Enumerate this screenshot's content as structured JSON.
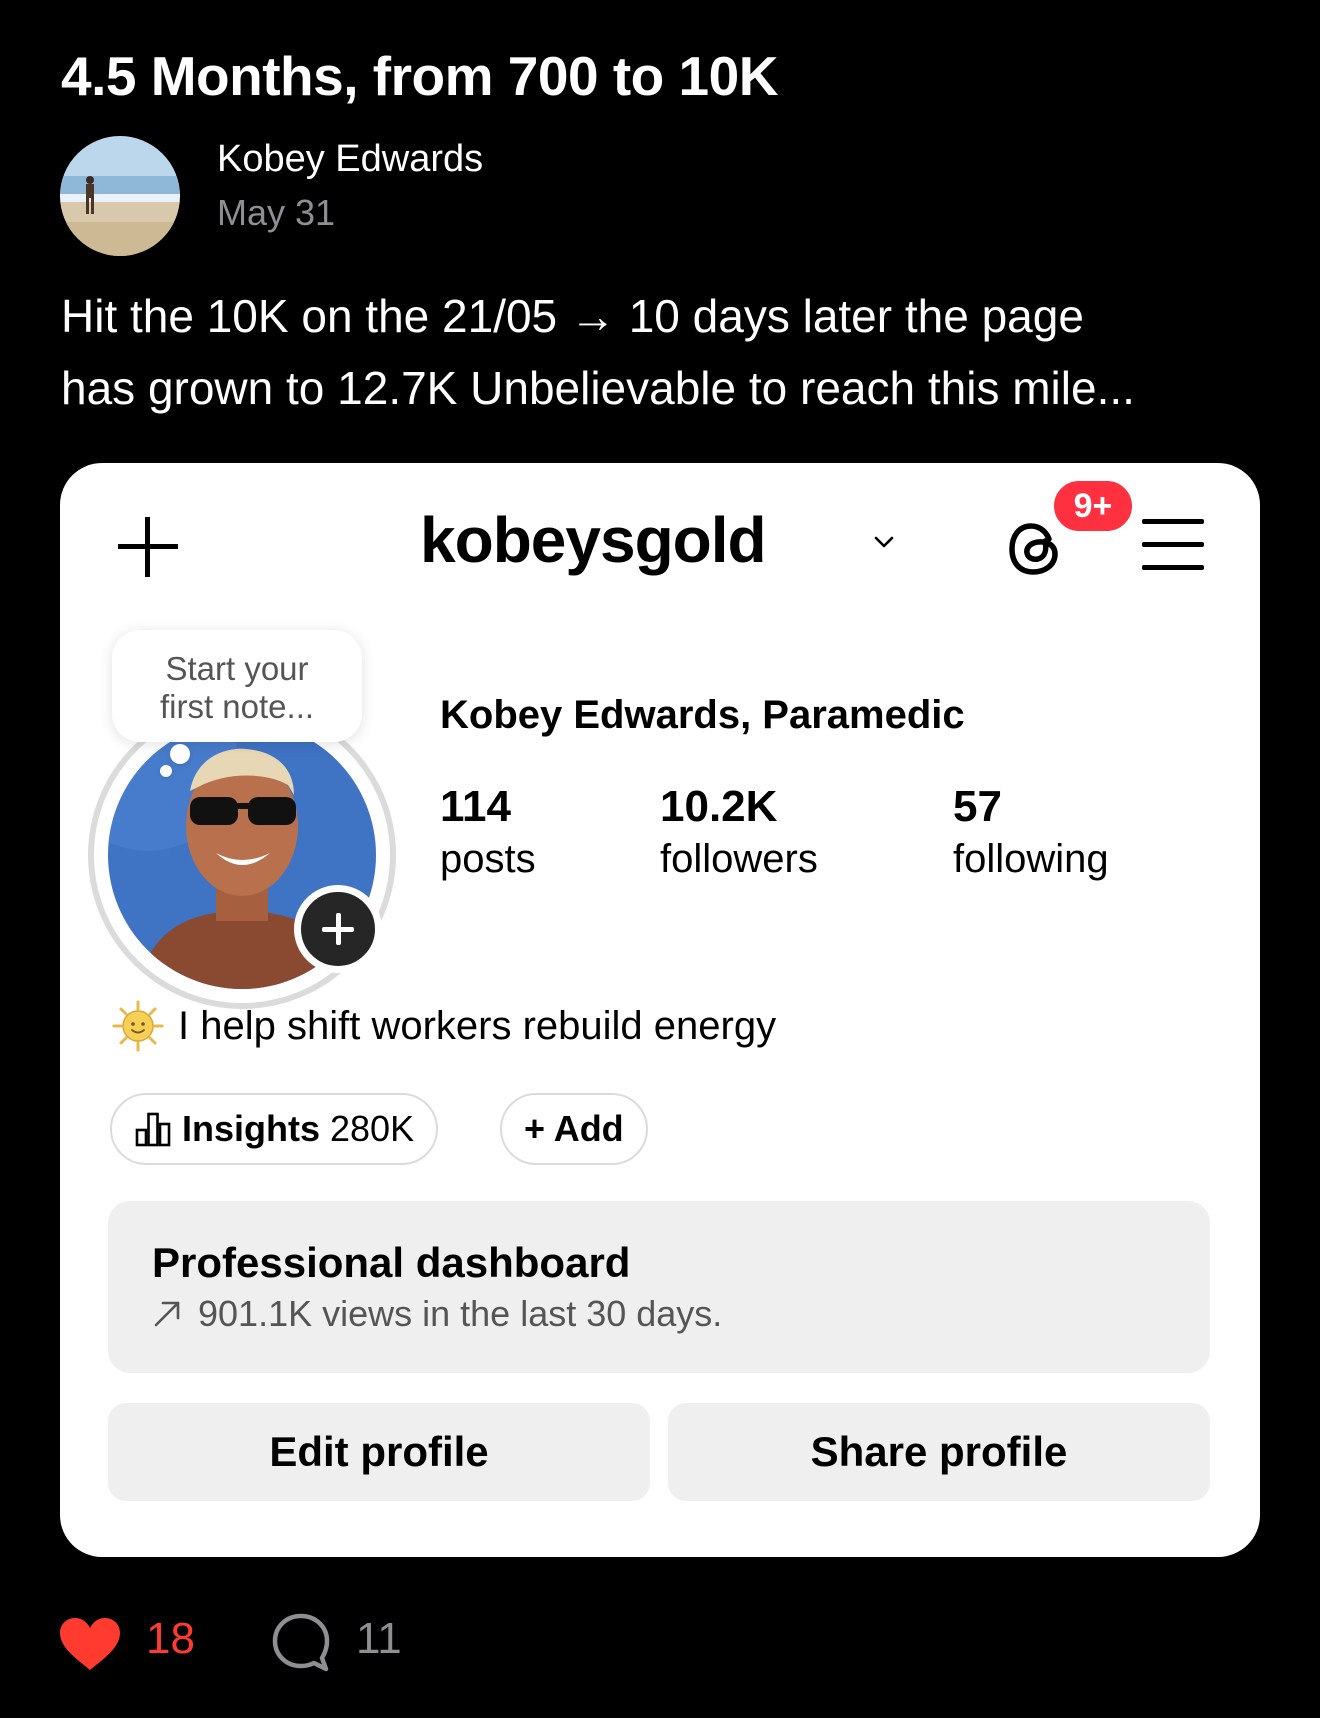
{
  "post": {
    "title": "4.5 Months, from 700 to 10K",
    "author": "Kobey Edwards",
    "date": "May 31",
    "body_line1": "Hit the 10K on the 21/05 → 10 days later the page",
    "body_line2": "has grown to 12.7K  Unbelievable to reach this mile..."
  },
  "profile": {
    "username": "kobeysgold",
    "notification_badge": "9+",
    "note_line1": "Start your",
    "note_line2": "first note...",
    "display_name": "Kobey Edwards, Paramedic",
    "stats": [
      {
        "value": "114",
        "label": "posts"
      },
      {
        "value": "10.2K",
        "label": "followers"
      },
      {
        "value": "57",
        "label": "following"
      }
    ],
    "bio": "I help shift workers rebuild energy",
    "insights_label": "Insights",
    "insights_value": "280K",
    "add_label": "+ Add",
    "dashboard_title": "Professional dashboard",
    "dashboard_subtitle": "901.1K views in the last 30 days.",
    "edit_profile": "Edit profile",
    "share_profile": "Share profile"
  },
  "engagement": {
    "likes": "18",
    "comments": "11"
  },
  "colors": {
    "like": "#ff3b30",
    "badge": "#ff3040",
    "muted": "#8e8e93"
  },
  "icons": [
    "heart-icon",
    "comment-icon",
    "plus-icon",
    "threads-icon",
    "menu-icon",
    "chevron-down-icon",
    "sun-icon",
    "bar-chart-icon",
    "trend-arrow-icon"
  ]
}
